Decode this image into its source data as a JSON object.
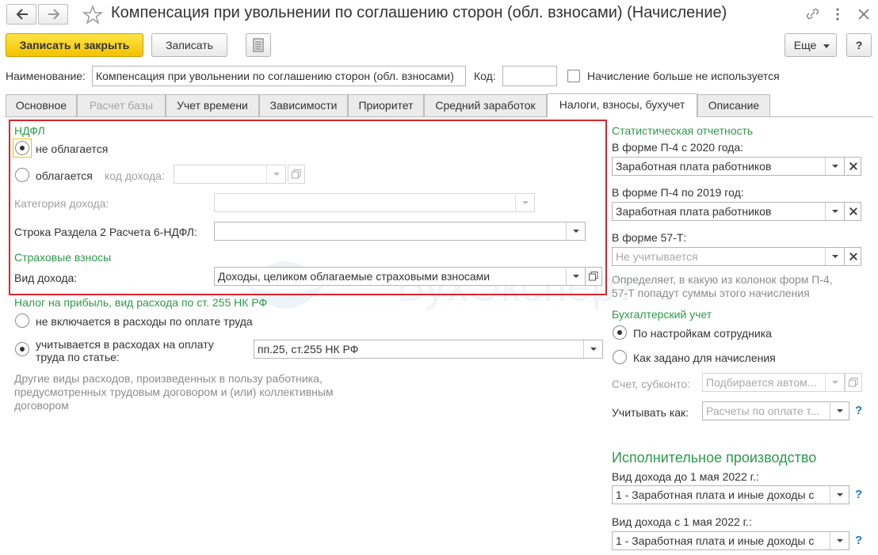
{
  "window": {
    "title": "Компенсация при увольнении по соглашению сторон (обл. взносами) (Начисление)"
  },
  "toolbar": {
    "save_close": "Записать и закрыть",
    "save": "Записать",
    "more": "Еще",
    "help": "?"
  },
  "header": {
    "name_label": "Наименование:",
    "name_value": "Компенсация при увольнении по соглашению сторон (обл. взносами)",
    "code_label": "Код:",
    "code_value": "",
    "unused_label": "Начисление больше не используется"
  },
  "tabs": [
    {
      "label": "Основное"
    },
    {
      "label": "Расчет базы"
    },
    {
      "label": "Учет времени"
    },
    {
      "label": "Зависимости"
    },
    {
      "label": "Приоритет"
    },
    {
      "label": "Средний заработок"
    },
    {
      "label": "Налоги, взносы, бухучет"
    },
    {
      "label": "Описание"
    }
  ],
  "left": {
    "ndfl_title": "НДФЛ",
    "not_taxed": "не облагается",
    "taxed": "облагается",
    "income_code_label": "код дохода:",
    "income_category_label": "Категория дохода:",
    "row6_label": "Строка Раздела 2 Расчета 6-НДФЛ:",
    "insurance_title": "Страховые взносы",
    "income_type_label": "Вид дохода:",
    "income_type_value": "Доходы, целиком облагаемые страховыми взносами",
    "profit_tax_title": "Налог на прибыль, вид расхода по ст. 255 НК РФ",
    "not_included": "не включается в расходы по оплате труда",
    "included_line1": "учитывается в расходах на оплату",
    "included_line2": "труда по статье:",
    "article_value": "пп.25, ст.255 НК РФ",
    "note_line1": "Другие виды расходов, произведенных в пользу работника,",
    "note_line2": "предусмотренных трудовым договором и (или) коллективным",
    "note_line3": "договором"
  },
  "right": {
    "stat_title": "Статистическая отчетность",
    "p4_2020_label": "В форме П-4 с 2020 года:",
    "p4_2020_value": "Заработная плата работников",
    "p4_2019_label": "В форме П-4 по 2019 год:",
    "p4_2019_value": "Заработная плата работников",
    "f57_label": "В форме 57-Т:",
    "f57_placeholder": "Не учитывается",
    "stat_note_line1": "Определяет, в какую из колонок форм П-4,",
    "stat_note_line2": "57-Т попадут суммы этого начисления",
    "acc_title": "Бухгалтерский учет",
    "acc_opt1": "По настройкам сотрудника",
    "acc_opt2": "Как задано для начисления",
    "account_label": "Счет, субконто:",
    "account_placeholder": "Подбирается автом...",
    "reflect_label": "Учитывать как:",
    "reflect_placeholder": "Расчеты по оплате т...",
    "enf_title": "Исполнительное производство",
    "enf_before_label": "Вид дохода до 1 мая 2022 г.:",
    "enf_before_value": "1 - Заработная плата и иные доходы с",
    "enf_after_label": "Вид дохода с 1 мая 2022 г.:",
    "enf_after_value": "1 - Заработная плата и иные доходы с",
    "help": "?"
  },
  "watermark_text": "БухЭксперт"
}
